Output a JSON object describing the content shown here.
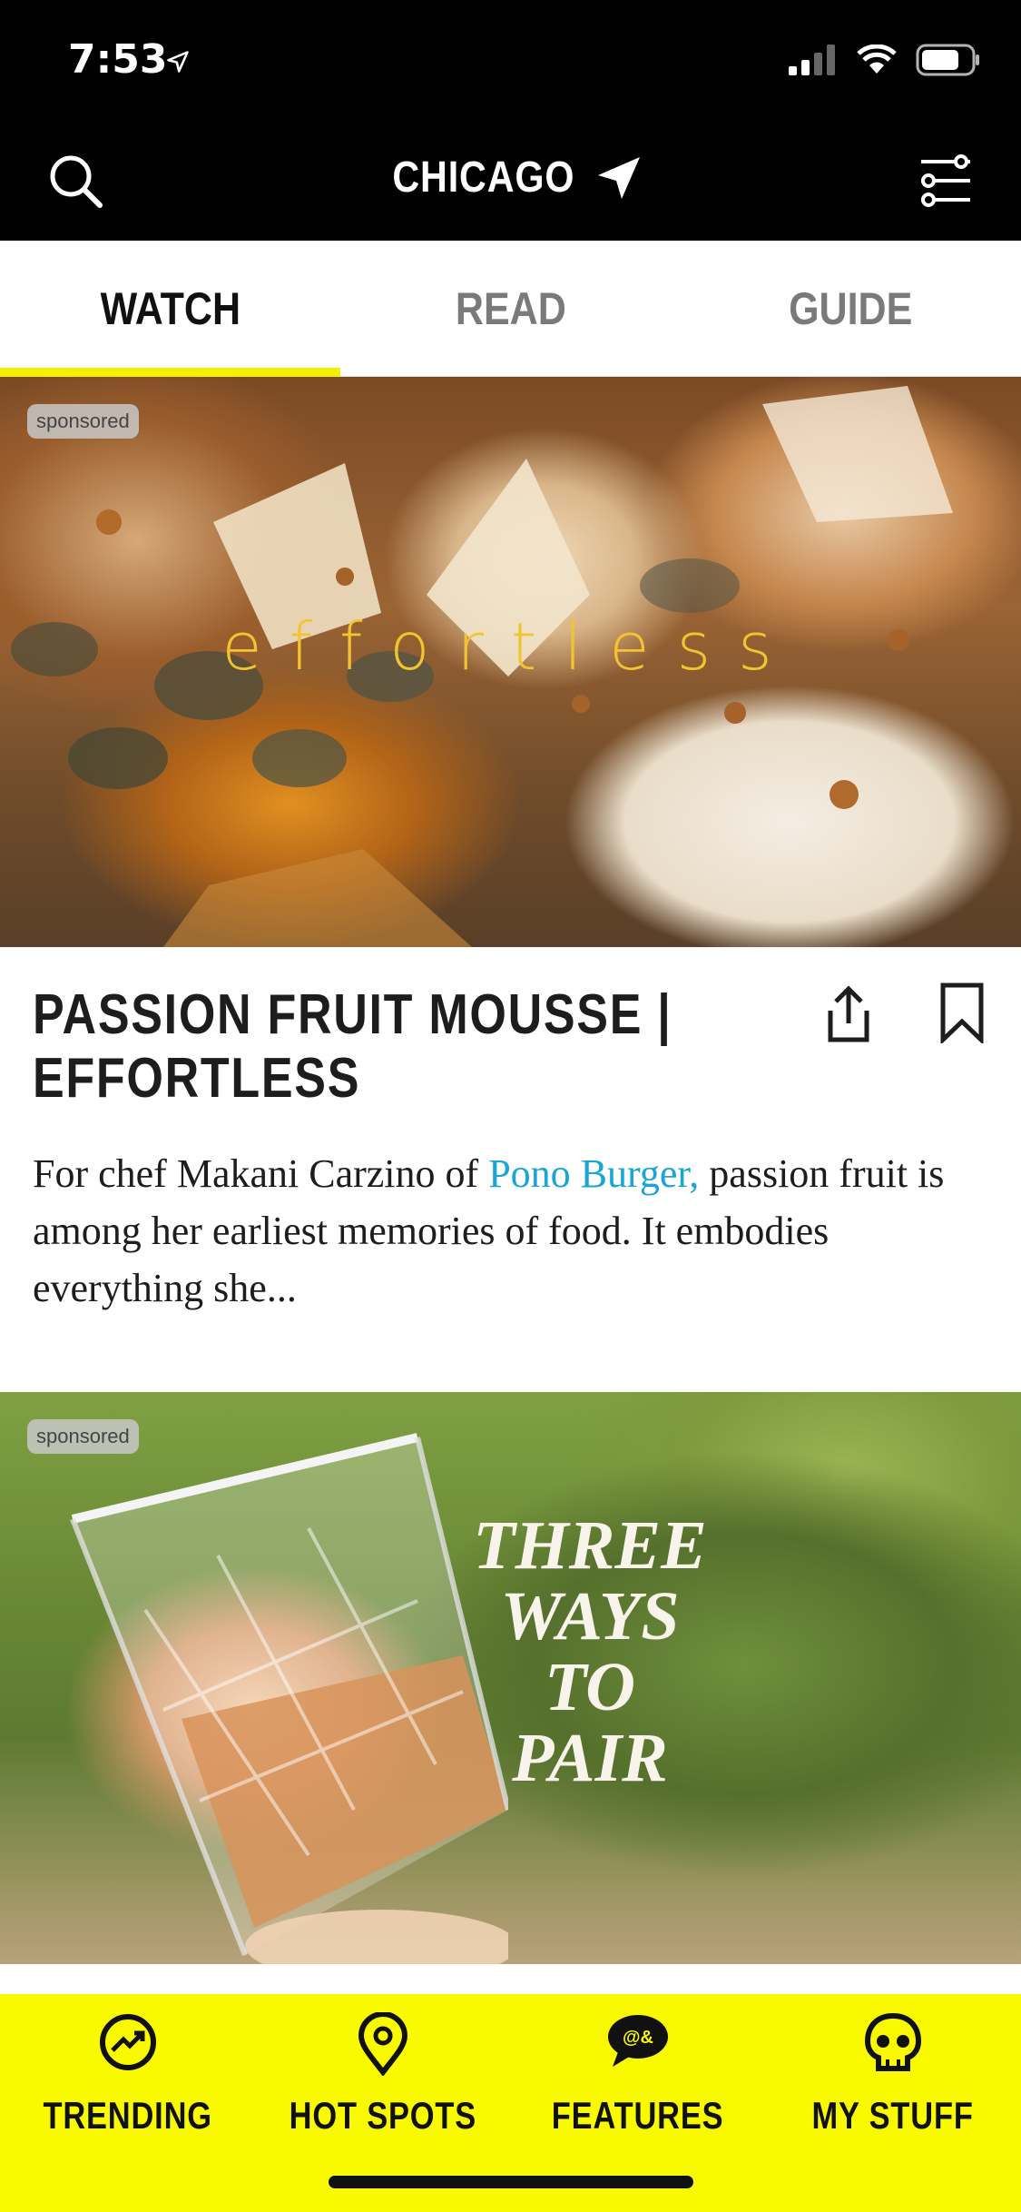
{
  "status_bar": {
    "time": "7:53"
  },
  "nav": {
    "city": "CHICAGO"
  },
  "tabs": [
    {
      "label": "WATCH",
      "active": true
    },
    {
      "label": "READ",
      "active": false
    },
    {
      "label": "GUIDE",
      "active": false
    }
  ],
  "cards": [
    {
      "badge": "sponsored",
      "image_overlay": "effortless",
      "title": "PASSION FRUIT MOUSSE | EFFORTLESS",
      "desc_prefix": "For chef Makani Carzino of ",
      "desc_link": "Pono Burger,",
      "desc_suffix": " passion fruit is among her earliest memories of food. It embodies everything she..."
    },
    {
      "badge": "sponsored",
      "image_overlay_lines": [
        "THREE",
        "WAYS",
        "TO",
        "PAIR"
      ]
    }
  ],
  "bottom_nav": [
    {
      "label": "TRENDING",
      "icon": "trending-icon",
      "active": false
    },
    {
      "label": "HOT SPOTS",
      "icon": "map-pin-icon",
      "active": false
    },
    {
      "label": "FEATURES",
      "icon": "features-chat-icon",
      "active": true
    },
    {
      "label": "MY STUFF",
      "icon": "skull-icon",
      "active": false
    }
  ],
  "colors": {
    "accent_yellow": "#F9F900",
    "link_blue": "#1AA5D6",
    "header_black": "#000000"
  }
}
